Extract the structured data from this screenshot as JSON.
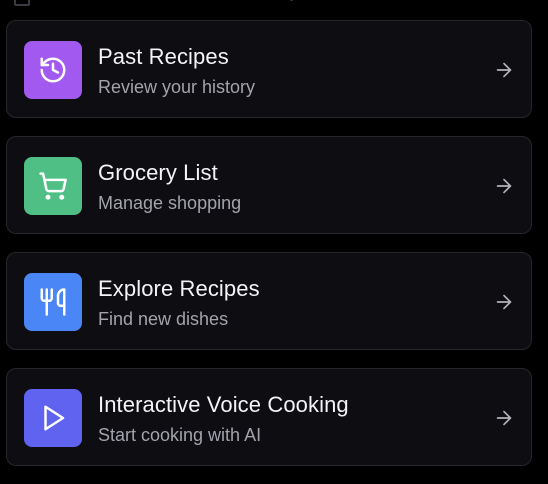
{
  "menu": {
    "items": [
      {
        "key": "past-recipes",
        "title": "Past Recipes",
        "subtitle": "Review your history",
        "icon": "history-icon",
        "color": "#a259f0"
      },
      {
        "key": "grocery-list",
        "title": "Grocery List",
        "subtitle": "Manage shopping",
        "icon": "cart-icon",
        "color": "#4fbf86"
      },
      {
        "key": "explore-recipes",
        "title": "Explore Recipes",
        "subtitle": "Find new dishes",
        "icon": "utensils-icon",
        "color": "#4a86f5"
      },
      {
        "key": "voice-cooking",
        "title": "Interactive Voice Cooking",
        "subtitle": "Start cooking with AI",
        "icon": "play-icon",
        "color": "#5f63f0"
      }
    ],
    "arrow_icon": "arrow-right-icon"
  }
}
